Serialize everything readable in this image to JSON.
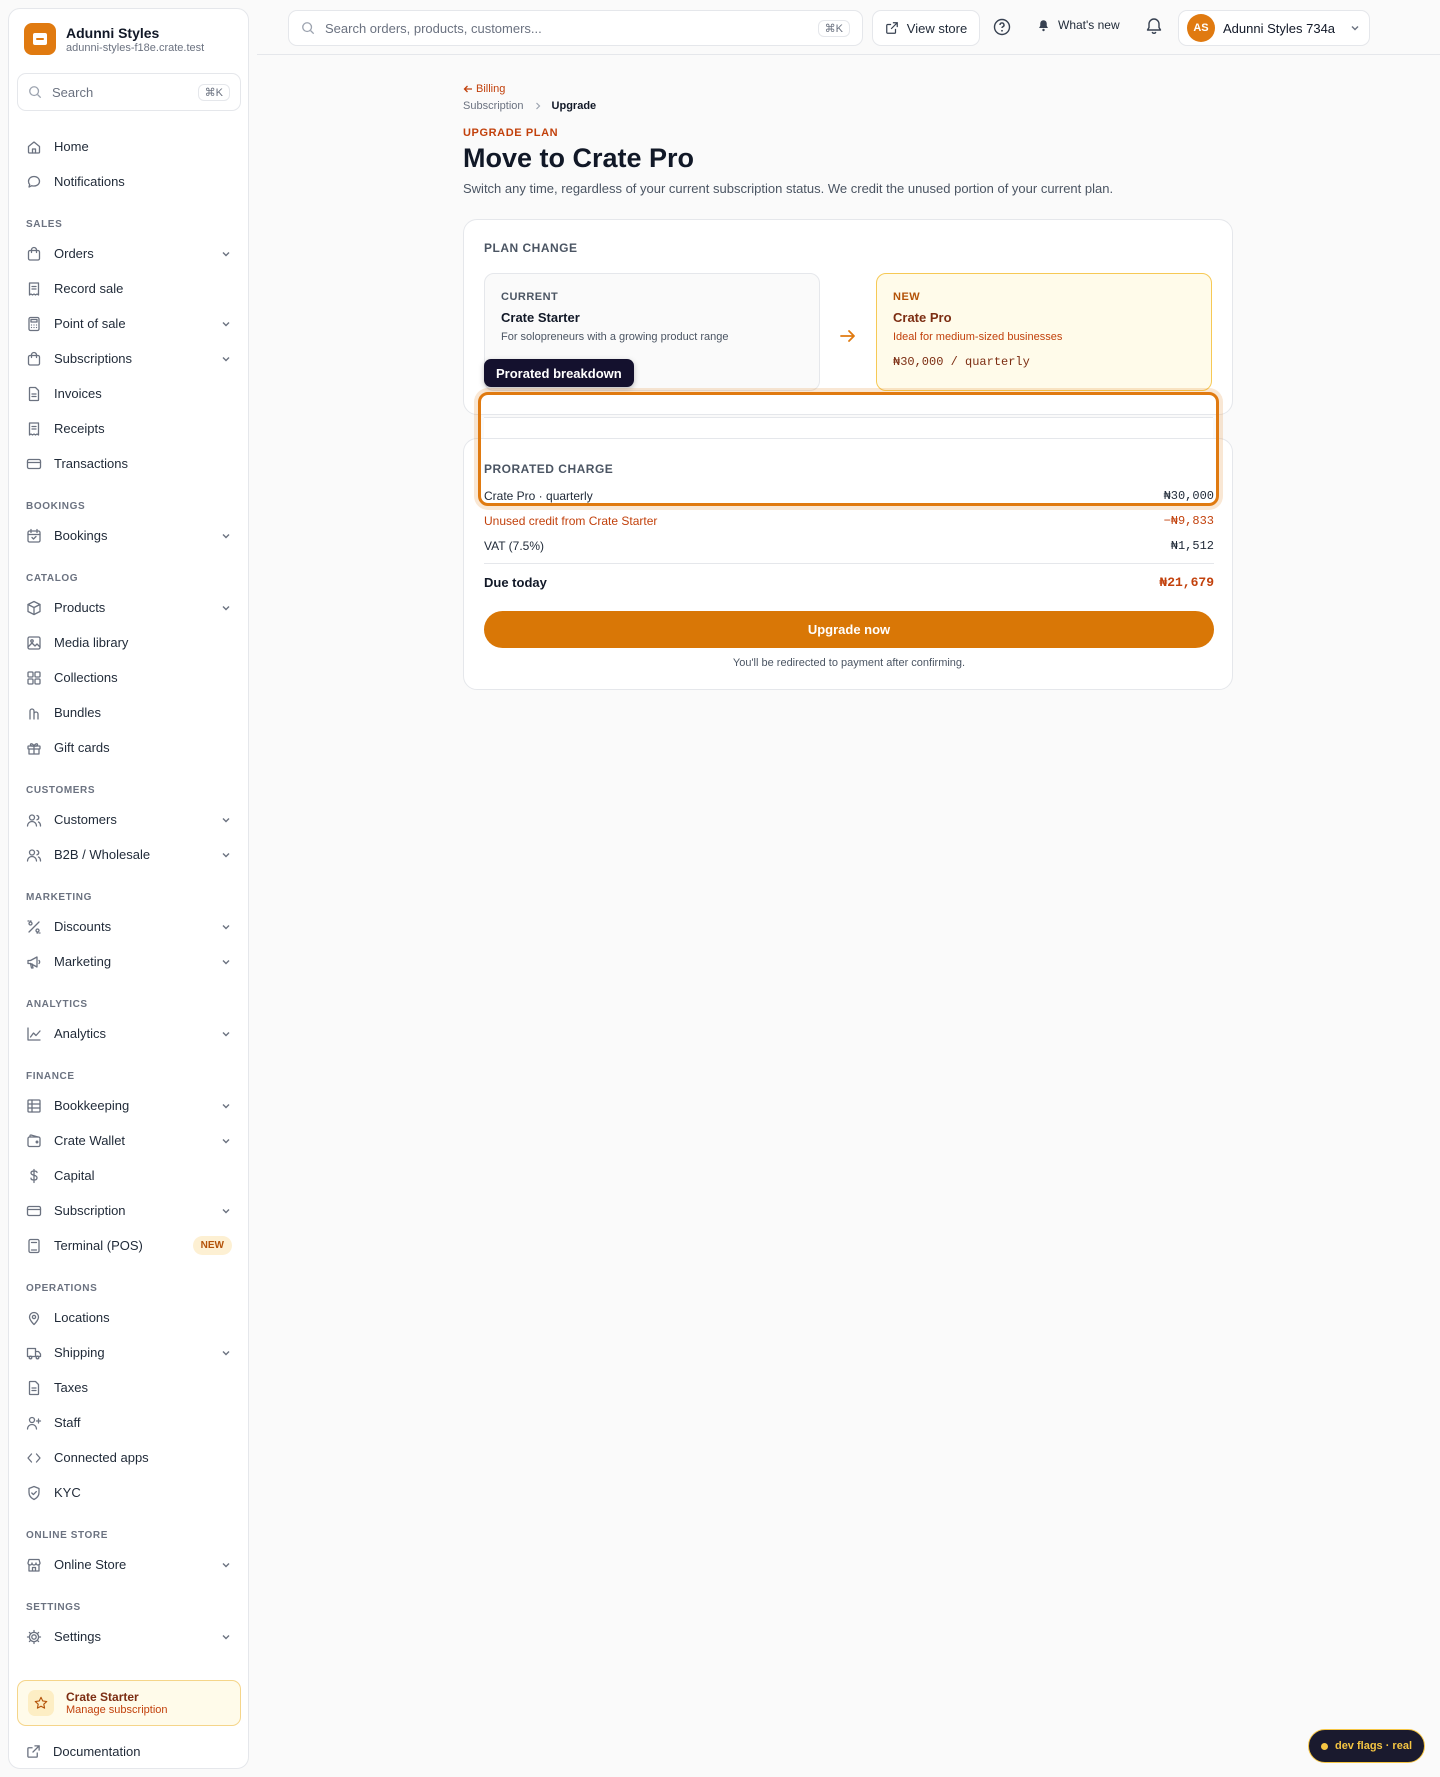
{
  "brand": {
    "name": "Adunni Styles",
    "domain": "adunni-styles-f18e.crate.test"
  },
  "sidebar": {
    "search_placeholder": "Search",
    "search_shortcut": "⌘K",
    "items": [
      {
        "label": "Home",
        "icon": "home-icon"
      },
      {
        "label": "Notifications",
        "icon": "chat-bubble-icon"
      },
      {
        "section": "SALES"
      },
      {
        "label": "Orders",
        "icon": "bag-icon",
        "chevron": true
      },
      {
        "label": "Record sale",
        "icon": "receipt-icon"
      },
      {
        "label": "Point of sale",
        "icon": "calculator-icon",
        "chevron": true
      },
      {
        "label": "Subscriptions",
        "icon": "bag-icon",
        "chevron": true
      },
      {
        "label": "Invoices",
        "icon": "document-icon"
      },
      {
        "label": "Receipts",
        "icon": "receipt-icon"
      },
      {
        "label": "Transactions",
        "icon": "card-icon"
      },
      {
        "section": "BOOKINGS"
      },
      {
        "label": "Bookings",
        "icon": "calendar-icon",
        "chevron": true
      },
      {
        "section": "CATALOG"
      },
      {
        "label": "Products",
        "icon": "box-icon",
        "chevron": true
      },
      {
        "label": "Media library",
        "icon": "image-icon"
      },
      {
        "label": "Collections",
        "icon": "grid-icon"
      },
      {
        "label": "Bundles",
        "icon": "bundle-icon"
      },
      {
        "label": "Gift cards",
        "icon": "gift-icon"
      },
      {
        "section": "CUSTOMERS"
      },
      {
        "label": "Customers",
        "icon": "users-icon",
        "chevron": true
      },
      {
        "label": "B2B / Wholesale",
        "icon": "users-icon",
        "chevron": true
      },
      {
        "section": "MARKETING"
      },
      {
        "label": "Discounts",
        "icon": "percent-icon",
        "chevron": true
      },
      {
        "label": "Marketing",
        "icon": "megaphone-icon",
        "chevron": true
      },
      {
        "section": "ANALYTICS"
      },
      {
        "label": "Analytics",
        "icon": "chart-icon",
        "chevron": true
      },
      {
        "section": "FINANCE"
      },
      {
        "label": "Bookkeeping",
        "icon": "ledger-icon",
        "chevron": true
      },
      {
        "label": "Crate Wallet",
        "icon": "wallet-icon",
        "chevron": true
      },
      {
        "label": "Capital",
        "icon": "dollar-icon"
      },
      {
        "label": "Subscription",
        "icon": "card-icon",
        "chevron": true
      },
      {
        "label": "Terminal (POS)",
        "icon": "terminal-icon",
        "badge": "NEW"
      },
      {
        "section": "OPERATIONS"
      },
      {
        "label": "Locations",
        "icon": "pin-icon"
      },
      {
        "label": "Shipping",
        "icon": "truck-icon",
        "chevron": true
      },
      {
        "label": "Taxes",
        "icon": "document-icon"
      },
      {
        "label": "Staff",
        "icon": "user-plus-icon"
      },
      {
        "label": "Connected apps",
        "icon": "code-icon"
      },
      {
        "label": "KYC",
        "icon": "shield-icon"
      },
      {
        "section": "ONLINE STORE"
      },
      {
        "label": "Online Store",
        "icon": "store-icon",
        "chevron": true
      },
      {
        "section": "SETTINGS"
      },
      {
        "label": "Settings",
        "icon": "gear-icon",
        "chevron": true
      }
    ],
    "plan": {
      "title": "Crate Starter",
      "subtitle": "Manage subscription"
    },
    "docs_label": "Documentation"
  },
  "topbar": {
    "search_placeholder": "Search orders, products, customers...",
    "search_shortcut": "⌘K",
    "view_store": "View store",
    "whats_new": "What's new",
    "avatar_initials": "AS",
    "account_name": "Adunni Styles 734a"
  },
  "page": {
    "back_label": "Billing",
    "breadcrumb": [
      "Subscription",
      "Upgrade"
    ],
    "eyebrow": "UPGRADE PLAN",
    "title": "Move to Crate Pro",
    "subtitle": "Switch any time, regardless of your current subscription status. We credit the unused portion of your current plan."
  },
  "plan_change": {
    "label": "PLAN CHANGE",
    "current": {
      "tag": "CURRENT",
      "name": "Crate Starter",
      "desc": "For solopreneurs with a growing product range"
    },
    "new": {
      "tag": "NEW",
      "name": "Crate Pro",
      "desc": "Ideal for medium-sized businesses",
      "price": "₦30,000 / quarterly"
    },
    "tooltip": "Prorated breakdown"
  },
  "prorated": {
    "label": "PRORATED CHARGE",
    "lines": [
      {
        "label": "Crate Pro · quarterly",
        "amount": "₦30,000"
      },
      {
        "label": "Unused credit from Crate Starter",
        "amount": "−₦9,833"
      },
      {
        "label": "VAT (7.5%)",
        "amount": "₦1,512"
      }
    ],
    "total_label": "Due today",
    "total_amount": "₦21,679",
    "cta": "Upgrade now",
    "note": "You'll be redirected to payment after confirming."
  },
  "dev_flags": "dev flags · real",
  "colors": {
    "accent": "#d97706",
    "accent_dark": "#c2410c",
    "tooltip_bg": "#14112e"
  }
}
